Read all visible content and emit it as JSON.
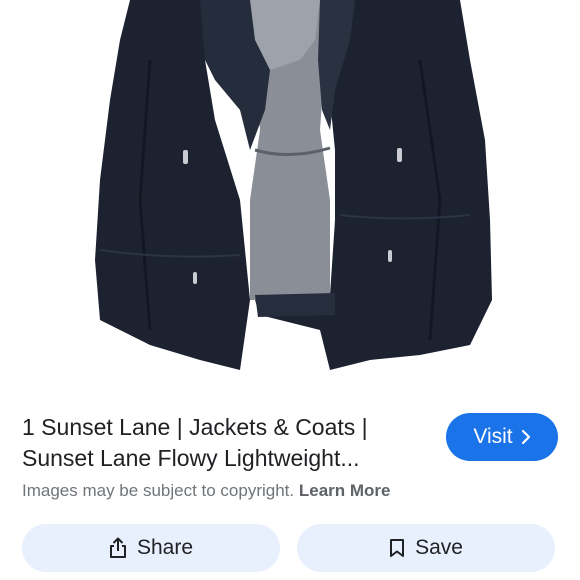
{
  "result": {
    "title": "1 Sunset Lane | Jackets & Coats | Sunset Lane Flowy Lightweight...",
    "visit_label": "Visit",
    "copyright_text": "Images may be subject to copyright.",
    "learn_more_label": "Learn More"
  },
  "actions": {
    "share_label": "Share",
    "save_label": "Save"
  },
  "icons": {
    "visit": "chevron-right-icon",
    "share": "share-icon",
    "save": "bookmark-icon"
  },
  "colors": {
    "accent": "#1a73e8",
    "pill_bg": "#e8f0fe",
    "jacket": "#1c2230",
    "lining": "#8a8e96"
  }
}
